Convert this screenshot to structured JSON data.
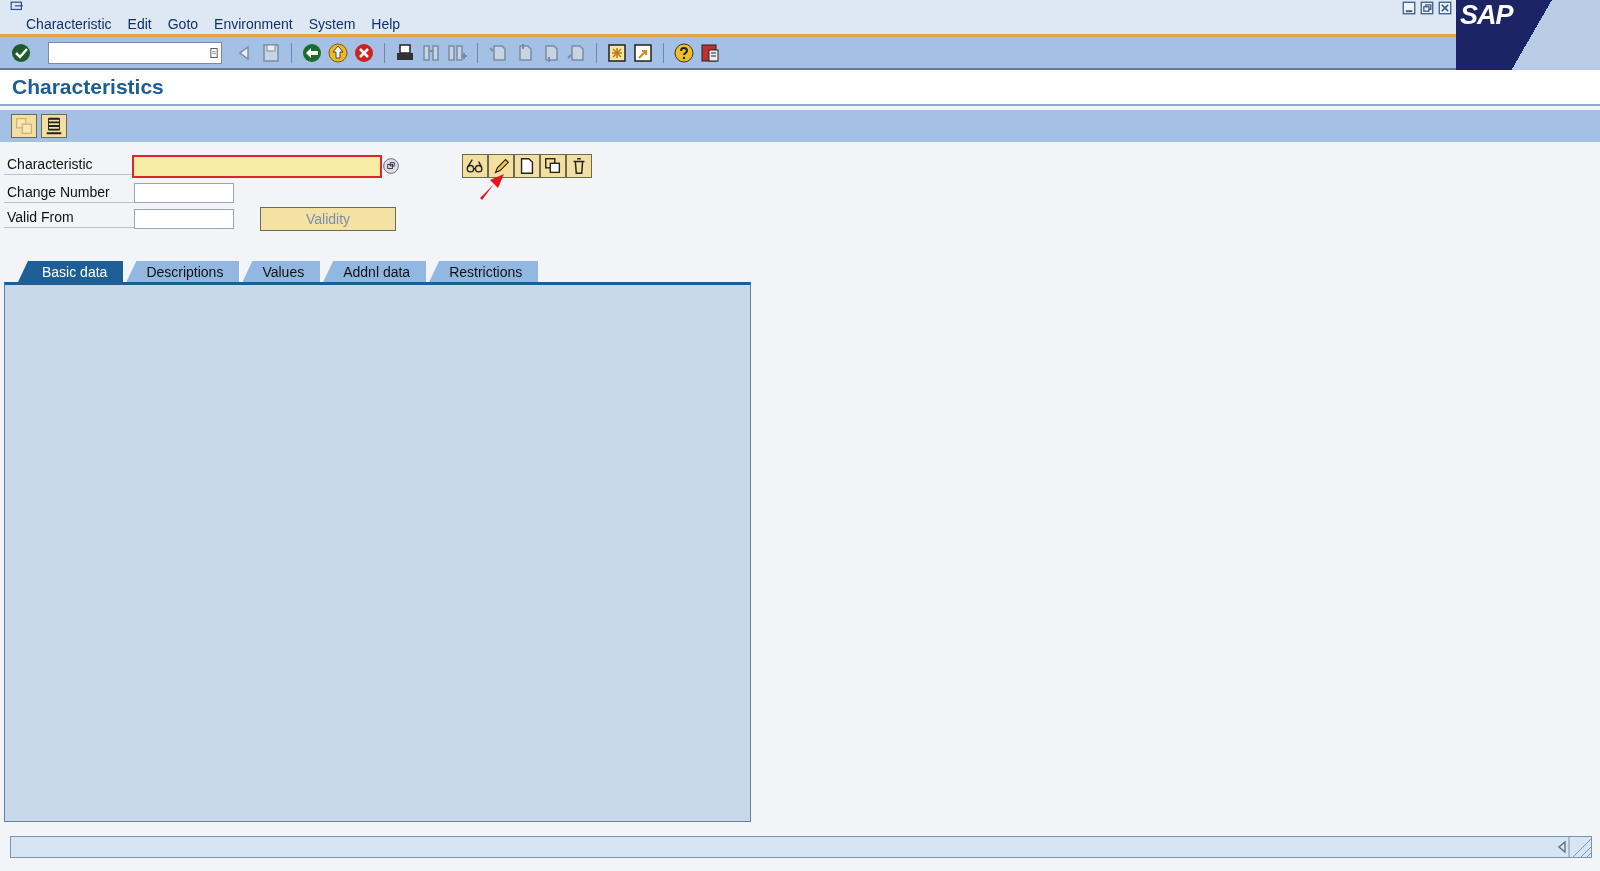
{
  "window": {
    "logo": "SAP"
  },
  "menu": [
    "Characteristic",
    "Edit",
    "Goto",
    "Environment",
    "System",
    "Help"
  ],
  "title": "Characteristics",
  "fields": [
    {
      "label": "Characteristic",
      "kind": "required"
    },
    {
      "label": "Change Number",
      "kind": "plain"
    },
    {
      "label": "Valid From",
      "kind": "plain"
    }
  ],
  "validity_button": {
    "label": "Validity",
    "disabled": true
  },
  "tabs": [
    {
      "label": "Basic data",
      "selected": true
    },
    {
      "label": "Descriptions",
      "selected": false
    },
    {
      "label": "Values",
      "selected": false
    },
    {
      "label": "Addnl data",
      "selected": false
    },
    {
      "label": "Restrictions",
      "selected": false
    }
  ]
}
